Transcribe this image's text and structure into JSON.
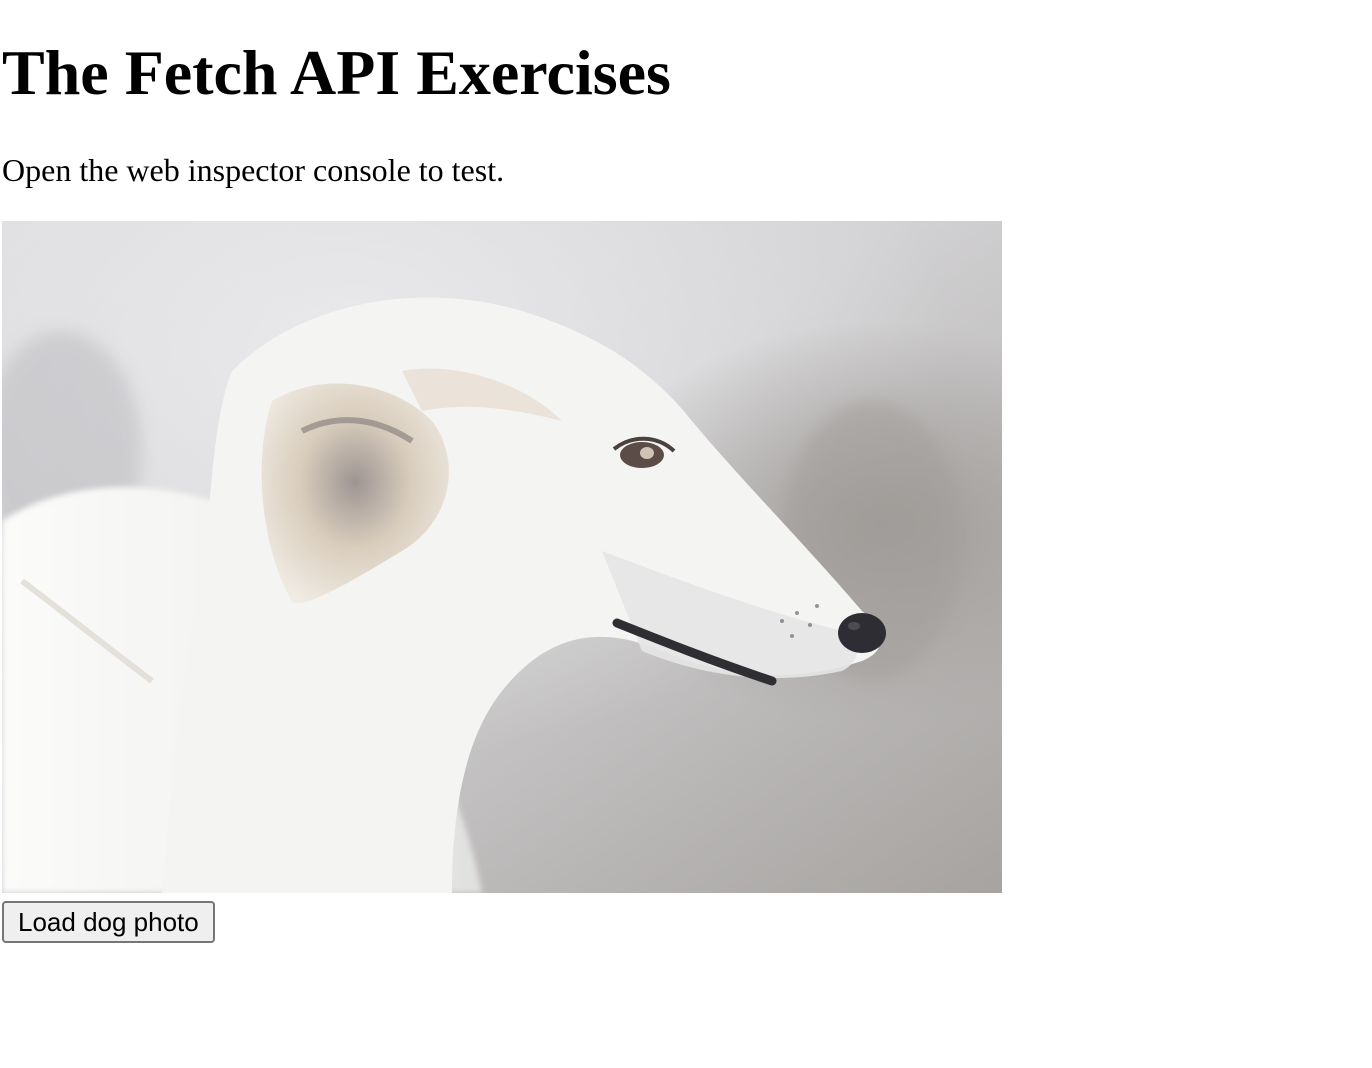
{
  "page": {
    "title": "The Fetch API Exercises",
    "intro": "Open the web inspector console to test.",
    "photo": {
      "alt": "white borzoi dog in profile",
      "colors": {
        "background_light": "#d9d9dc",
        "background_dark": "#a9a6a4",
        "fur": "#f3f3f1",
        "shadow": "#b7b5b3",
        "ear_tan": "#d8cdbc",
        "nose": "#2e2d33"
      }
    },
    "button": {
      "label": "Load dog photo"
    }
  }
}
